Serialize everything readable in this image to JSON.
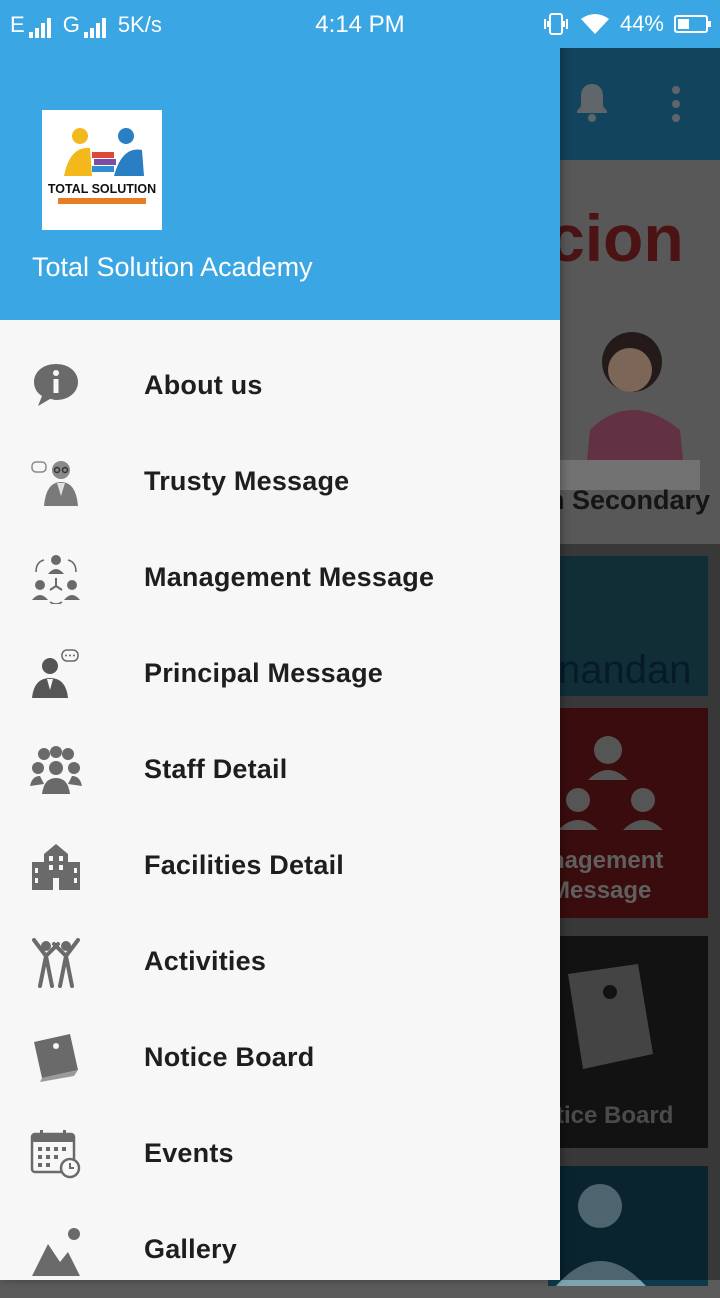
{
  "status_bar": {
    "network_1": "E",
    "network_2": "G",
    "speed": "5K/s",
    "time": "4:14 PM",
    "battery": "44%",
    "battery_level": 0.44
  },
  "drawer": {
    "logo_text": "TOTAL SOLUTION",
    "title": "Total Solution Academy",
    "items": [
      {
        "label": "About us",
        "icon": "info-icon"
      },
      {
        "label": "Trusty Message",
        "icon": "trustee-icon"
      },
      {
        "label": "Management Message",
        "icon": "management-icon"
      },
      {
        "label": "Principal Message",
        "icon": "principal-icon"
      },
      {
        "label": "Staff Detail",
        "icon": "staff-icon"
      },
      {
        "label": "Facilities Detail",
        "icon": "building-icon"
      },
      {
        "label": "Activities",
        "icon": "activities-icon"
      },
      {
        "label": "Notice Board",
        "icon": "notice-icon"
      },
      {
        "label": "Events",
        "icon": "calendar-icon"
      },
      {
        "label": "Gallery",
        "icon": "gallery-icon"
      }
    ]
  },
  "background": {
    "banner_word": "cion",
    "banner_sub": "h Secondary",
    "tile1": "nandan",
    "tile2_line1": "nagement",
    "tile2_line2": "Message",
    "tile3": "tice Board"
  },
  "colors": {
    "primary": "#3aa6e3",
    "drawer_bg": "#f7f7f7",
    "icon_gray": "#6a6a6a"
  }
}
